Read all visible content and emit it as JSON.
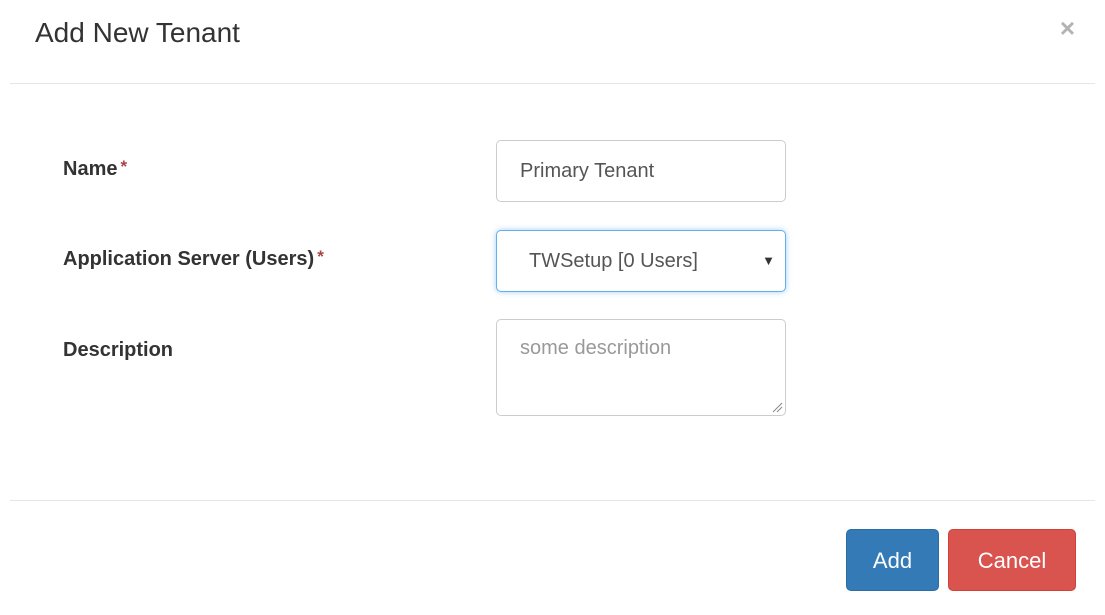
{
  "dialog": {
    "title": "Add New Tenant",
    "close_icon": "close-icon",
    "close_glyph": "×"
  },
  "form": {
    "required_marker": "*",
    "name": {
      "label": "Name",
      "required": true,
      "value": "Primary Tenant"
    },
    "app_server": {
      "label": "Application Server (Users)",
      "required": true,
      "selected": "TWSetup [0 Users]",
      "arrow_icon": "chevron-down-icon",
      "arrow_glyph": "▼"
    },
    "description": {
      "label": "Description",
      "required": false,
      "value": "",
      "placeholder": "some description"
    }
  },
  "footer": {
    "add_label": "Add",
    "cancel_label": "Cancel"
  },
  "colors": {
    "primary": "#337ab7",
    "danger": "#d9534f",
    "required": "#a94442",
    "focus": "#66afe9"
  }
}
